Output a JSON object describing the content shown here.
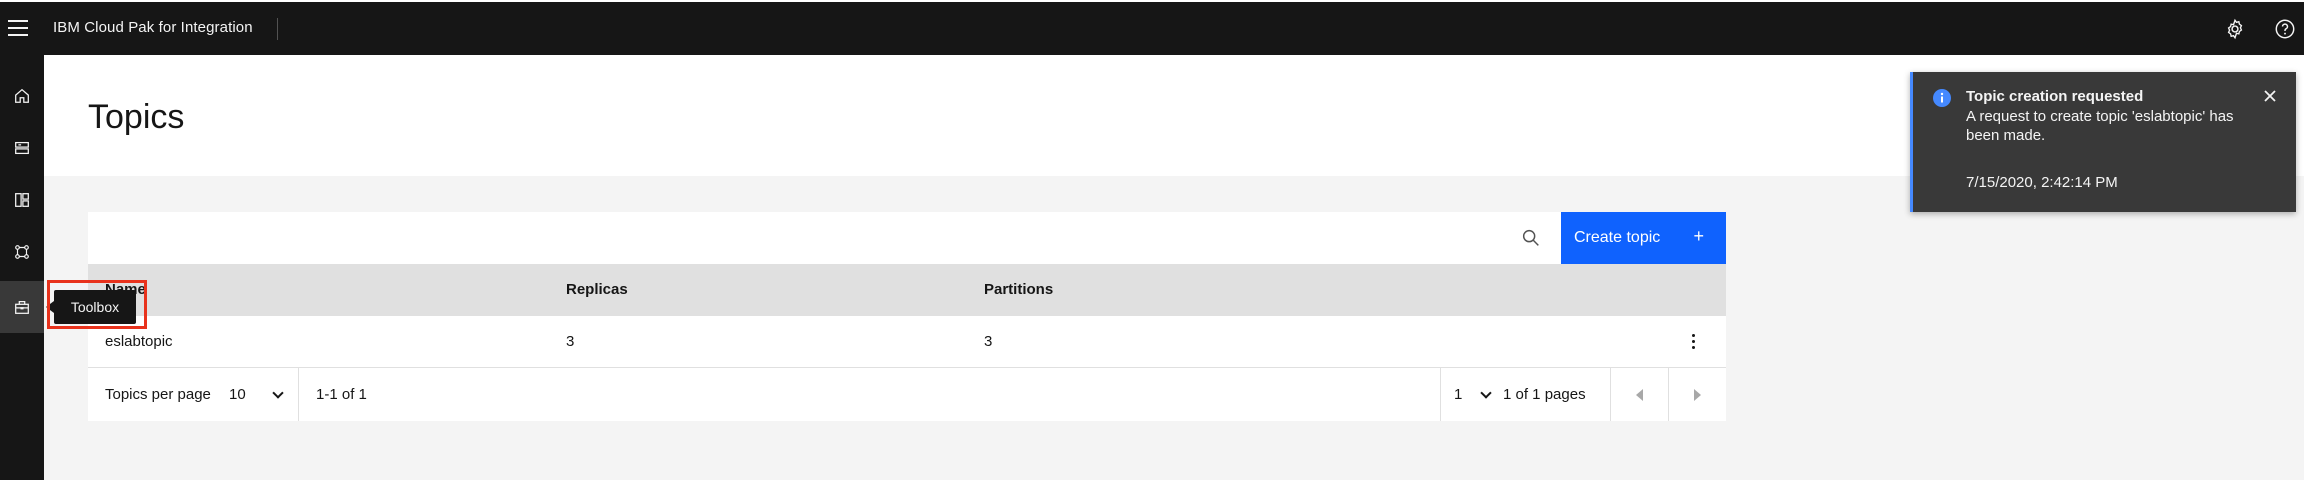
{
  "header": {
    "app_title": "IBM Cloud Pak for Integration",
    "icons": [
      "menu-icon",
      "settings-icon",
      "help-icon"
    ]
  },
  "sidenav": {
    "items": [
      {
        "icon": "home-icon"
      },
      {
        "icon": "storage-icon"
      },
      {
        "icon": "layout-icon"
      },
      {
        "icon": "network-icon"
      },
      {
        "icon": "toolbox-icon",
        "active": true
      }
    ],
    "tooltip": "Toolbox"
  },
  "page": {
    "title": "Topics"
  },
  "table": {
    "create_button": "Create topic",
    "columns": [
      "Name",
      "Replicas",
      "Partitions"
    ],
    "rows": [
      {
        "name": "eslabtopic",
        "replicas": "3",
        "partitions": "3"
      }
    ],
    "pagination": {
      "per_page_label": "Topics per page",
      "per_page_value": "10",
      "range": "1-1 of 1",
      "current_page": "1",
      "pages_label": "1 of 1 pages"
    }
  },
  "toast": {
    "title": "Topic creation requested",
    "body": "A request to create topic 'eslabtopic' has been made.",
    "timestamp": "7/15/2020, 2:42:14 PM"
  },
  "colors": {
    "primary": "#0f62fe",
    "header_bg": "#161616",
    "toast_bg": "#393939",
    "info_accent": "#4589ff",
    "highlight": "#e8321c"
  }
}
